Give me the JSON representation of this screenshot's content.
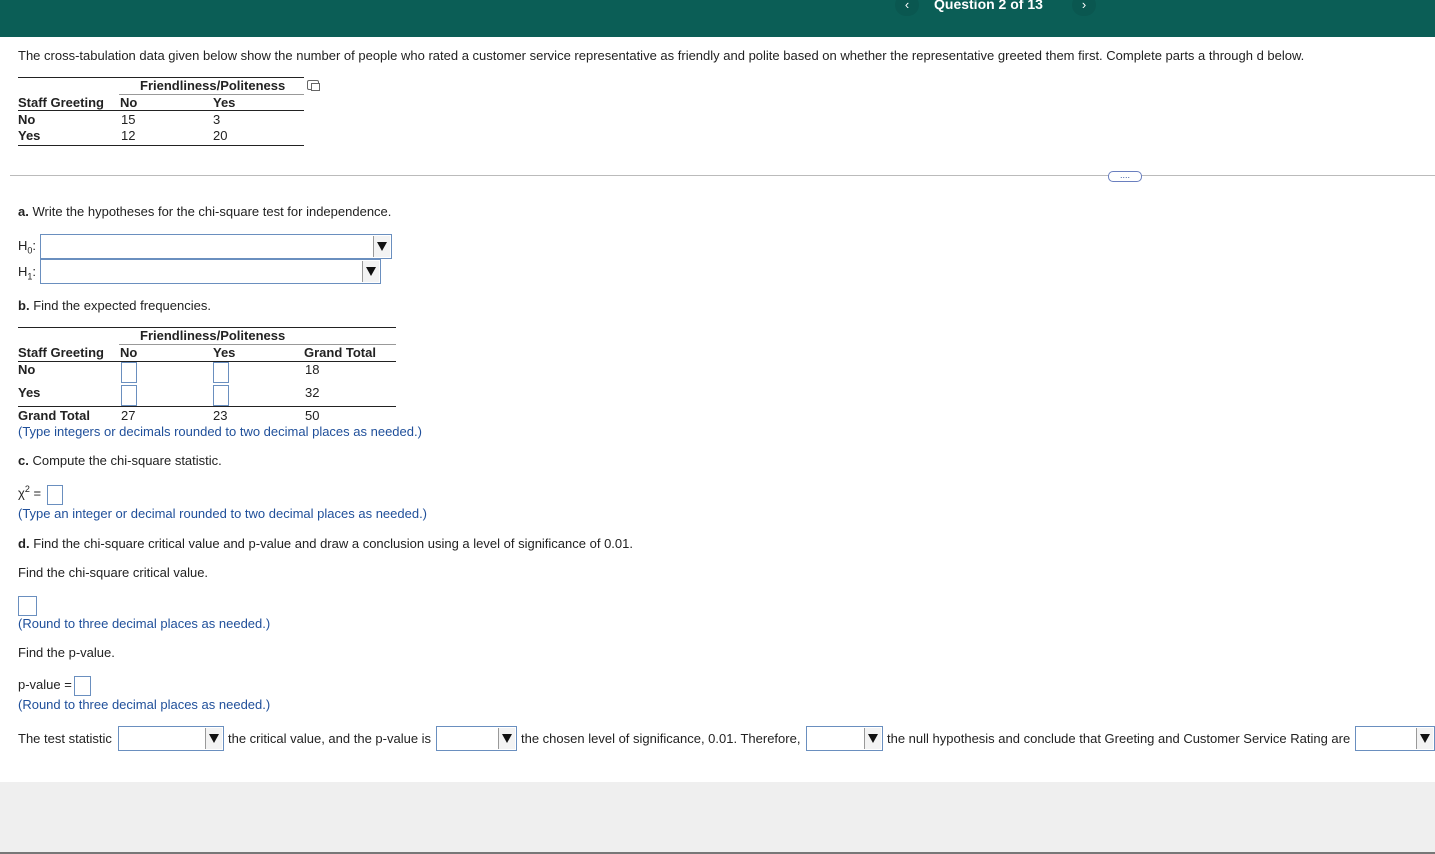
{
  "header": {
    "question_label": "Question 2 of 13",
    "prev_symbol": "‹",
    "next_symbol": "›"
  },
  "intro": "The cross-tabulation data given below show the number of people who rated a customer service representative as friendly and polite based on whether the representative greeted them first. Complete parts a through d below.",
  "table1": {
    "group_header": "Friendliness/Politeness",
    "row_header": "Staff Greeting",
    "col_no": "No",
    "col_yes": "Yes",
    "rows": [
      {
        "label": "No",
        "no": "15",
        "yes": "3"
      },
      {
        "label": "Yes",
        "no": "12",
        "yes": "20"
      }
    ]
  },
  "more_button": "....",
  "part_a": {
    "prompt": "Write the hypotheses for the chi-square test for independence.",
    "letter": "a.",
    "h0_label": "H",
    "h0_sub": "0",
    "h1_label": "H",
    "h1_sub": "1",
    "colon": ":"
  },
  "part_b": {
    "letter": "b.",
    "prompt": "Find the expected frequencies.",
    "group_header": "Friendliness/Politeness",
    "row_header": "Staff Greeting",
    "col_no": "No",
    "col_yes": "Yes",
    "col_total": "Grand Total",
    "rows": [
      {
        "label": "No",
        "total": "18"
      },
      {
        "label": "Yes",
        "total": "32"
      }
    ],
    "grand_row": {
      "label": "Grand Total",
      "no": "27",
      "yes": "23",
      "total": "50"
    },
    "hint": "(Type integers or decimals rounded to two decimal places as needed.)"
  },
  "part_c": {
    "letter": "c.",
    "prompt": "Compute the chi-square statistic.",
    "chi_symbol": "χ",
    "chi_sup": "2",
    "equals": "=",
    "hint": "(Type an integer or decimal rounded to two decimal places as needed.)"
  },
  "part_d": {
    "letter": "d.",
    "prompt": "Find the chi-square critical value and p-value and draw a conclusion using a level of significance of 0.01.",
    "crit_prompt": "Find the chi-square critical value.",
    "crit_hint": "(Round to three decimal places as needed.)",
    "p_prompt": "Find the p-value.",
    "p_label": "p-value =",
    "p_hint": "(Round to three decimal places as needed.)",
    "sentence": {
      "s1": "The test statistic",
      "s2": "the critical value, and the p-value is",
      "s3": "the chosen level of significance, 0.01. Therefore,",
      "s4": "the null hypothesis and conclude that Greeting and Customer Service Rating are"
    }
  }
}
